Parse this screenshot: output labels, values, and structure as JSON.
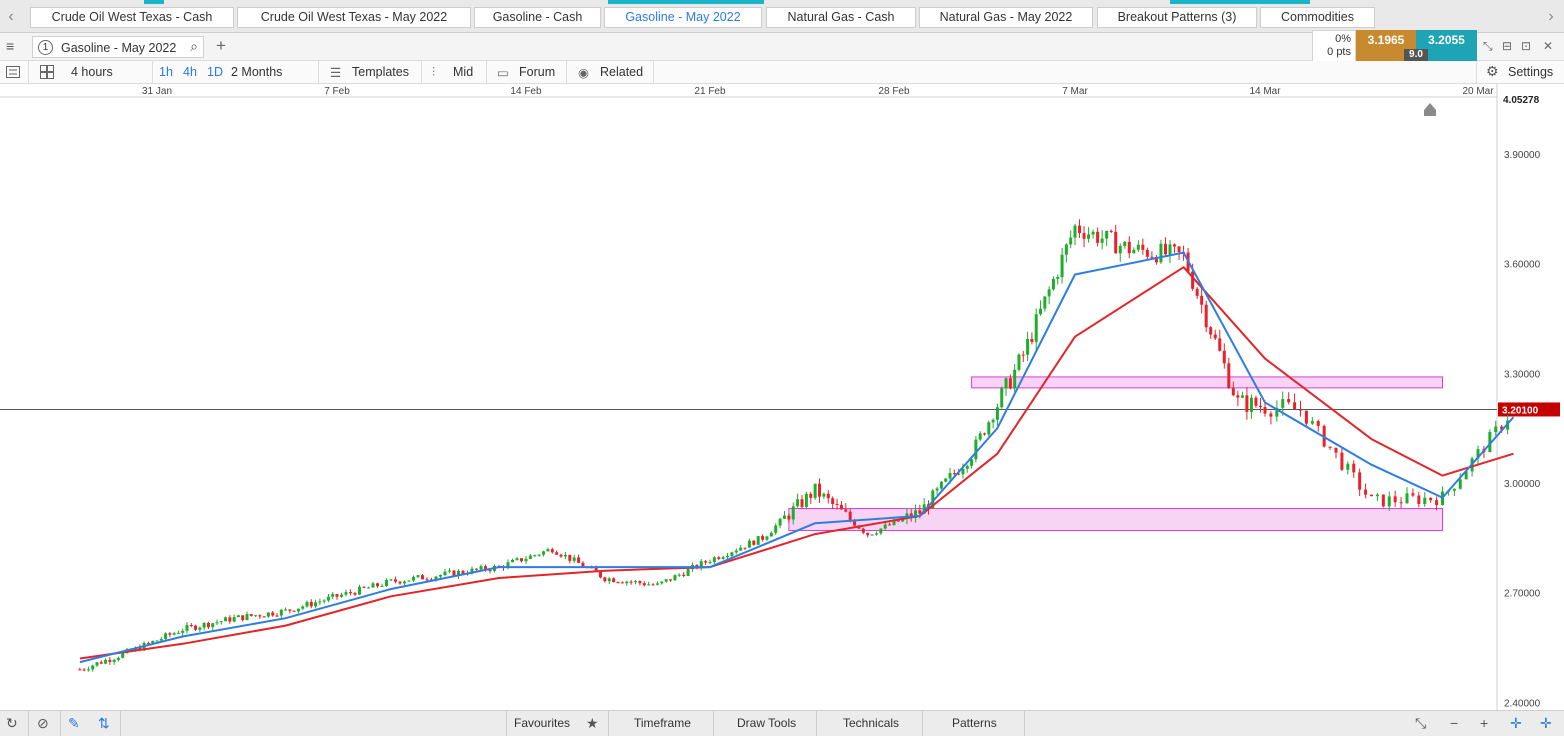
{
  "tabs": [
    {
      "label": "Crude Oil West Texas - Cash",
      "active": false
    },
    {
      "label": "Crude Oil West Texas - May 2022",
      "active": false
    },
    {
      "label": "Gasoline - Cash",
      "active": false
    },
    {
      "label": "Gasoline - May 2022",
      "active": true
    },
    {
      "label": "Natural Gas - Cash",
      "active": false
    },
    {
      "label": "Natural Gas - May 2022",
      "active": false
    },
    {
      "label": "Breakout Patterns (3)",
      "active": false
    },
    {
      "label": "Commodities",
      "active": false
    }
  ],
  "nav": {
    "prev": "‹",
    "next": "›"
  },
  "toolbar": {
    "menu_icon": "≡",
    "instrument_number": "1",
    "instrument_name": "Gasoline - May 2022",
    "search_icon": "⌕",
    "add_icon": "+",
    "change_pct": "0%",
    "change_pts": "0 pts",
    "bid": "3.1965",
    "ask": "3.2055",
    "spread": "9.0",
    "window_icons": [
      "⤡",
      "⊟",
      "⊡",
      "✕"
    ]
  },
  "toolbar2": {
    "interval": "4 hours",
    "quick_intervals": [
      "1h",
      "4h",
      "1D"
    ],
    "range": "2 Months",
    "templates": "Templates",
    "mid": "Mid",
    "forum": "Forum",
    "related": "Related",
    "settings": "Settings"
  },
  "colors": {
    "up_candle": "#1fae2c",
    "down_candle": "#e8212b",
    "ema_fast": "#2f7de1",
    "ema_slow": "#e3252a",
    "zone_fill": "#f8d4f4",
    "zone_stroke": "#e23ad6",
    "last_price_tag": "#c40000",
    "accent": "#19b5c9"
  },
  "chart_data": {
    "type": "candlestick",
    "instrument": "Gasoline - May 2022",
    "interval": "4 hours",
    "x_tick_labels": [
      "31 Jan",
      "7 Feb",
      "14 Feb",
      "21 Feb",
      "28 Feb",
      "7 Mar",
      "14 Mar",
      "20 Mar"
    ],
    "y_tick_labels": [
      "3.90000",
      "3.60000",
      "3.30000",
      "3.00000",
      "2.70000",
      "2.40000"
    ],
    "ylim": [
      2.39,
      4.05278
    ],
    "high_label": "4.05278",
    "last_price": 3.201,
    "last_price_label": "3.20100",
    "zones": [
      {
        "from_date": "3 Mar",
        "to_date": "19 Mar",
        "low": 3.26,
        "high": 3.29
      },
      {
        "from_date": "24 Feb",
        "to_date": "19 Mar",
        "low": 2.87,
        "high": 2.93
      }
    ],
    "close_path": [
      [
        "28 Jan",
        2.49
      ],
      [
        "30 Jan",
        2.54
      ],
      [
        "1 Feb",
        2.6
      ],
      [
        "3 Feb",
        2.63
      ],
      [
        "5 Feb",
        2.65
      ],
      [
        "7 Feb",
        2.69
      ],
      [
        "9 Feb",
        2.73
      ],
      [
        "11 Feb",
        2.75
      ],
      [
        "13 Feb",
        2.77
      ],
      [
        "15 Feb",
        2.82
      ],
      [
        "17 Feb",
        2.74
      ],
      [
        "19 Feb",
        2.72
      ],
      [
        "21 Feb",
        2.79
      ],
      [
        "23 Feb",
        2.85
      ],
      [
        "25 Feb",
        2.98
      ],
      [
        "27 Feb",
        2.86
      ],
      [
        "1 Mar",
        2.92
      ],
      [
        "3 Mar",
        3.08
      ],
      [
        "5 Mar",
        3.35
      ],
      [
        "7 Mar",
        3.7
      ],
      [
        "9 Mar",
        3.64
      ],
      [
        "11 Mar",
        3.62
      ],
      [
        "13 Mar",
        3.22
      ],
      [
        "15 Mar",
        3.2
      ],
      [
        "17 Mar",
        2.95
      ],
      [
        "19 Mar",
        2.96
      ],
      [
        "21 Mar",
        3.2
      ]
    ],
    "ema_fast_path": [
      [
        "28 Jan",
        2.51
      ],
      [
        "1 Feb",
        2.58
      ],
      [
        "5 Feb",
        2.63
      ],
      [
        "9 Feb",
        2.71
      ],
      [
        "13 Feb",
        2.77
      ],
      [
        "17 Feb",
        2.77
      ],
      [
        "21 Feb",
        2.77
      ],
      [
        "25 Feb",
        2.89
      ],
      [
        "1 Mar",
        2.91
      ],
      [
        "4 Mar",
        3.15
      ],
      [
        "7 Mar",
        3.57
      ],
      [
        "11 Mar",
        3.63
      ],
      [
        "14 Mar",
        3.22
      ],
      [
        "17 Mar",
        3.05
      ],
      [
        "19 Mar",
        2.96
      ],
      [
        "21 Mar",
        3.18
      ]
    ],
    "ema_slow_path": [
      [
        "28 Jan",
        2.52
      ],
      [
        "1 Feb",
        2.56
      ],
      [
        "5 Feb",
        2.61
      ],
      [
        "9 Feb",
        2.69
      ],
      [
        "13 Feb",
        2.74
      ],
      [
        "17 Feb",
        2.76
      ],
      [
        "21 Feb",
        2.77
      ],
      [
        "25 Feb",
        2.86
      ],
      [
        "1 Mar",
        2.91
      ],
      [
        "4 Mar",
        3.08
      ],
      [
        "7 Mar",
        3.4
      ],
      [
        "11 Mar",
        3.59
      ],
      [
        "14 Mar",
        3.34
      ],
      [
        "17 Mar",
        3.12
      ],
      [
        "19 Mar",
        3.02
      ],
      [
        "21 Mar",
        3.08
      ]
    ],
    "grid": false
  },
  "bottombar": {
    "favourites": "Favourites",
    "timeframe": "Timeframe",
    "draw_tools": "Draw Tools",
    "technicals": "Technicals",
    "patterns": "Patterns",
    "icons": [
      "↻",
      "⊘",
      "✎",
      "⇅",
      "★",
      "⤡",
      "−",
      "+",
      "✛",
      "✛"
    ]
  }
}
